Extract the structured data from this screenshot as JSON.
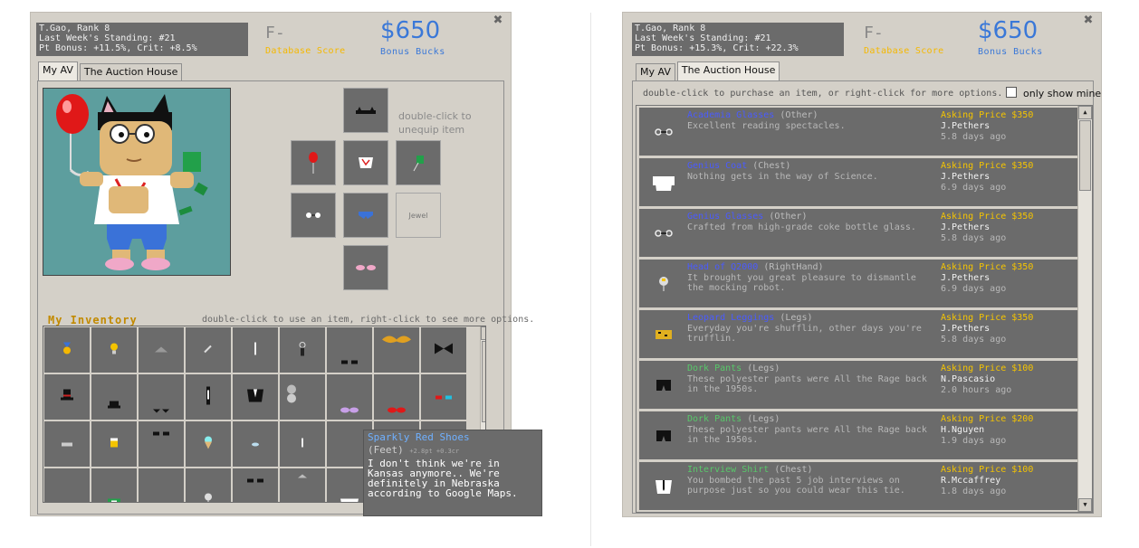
{
  "left": {
    "status": {
      "line1": "T.Gao, Rank 8",
      "line2": "Last Week's Standing: #21",
      "line3": "Pt Bonus: +11.5%, Crit: +8.5%"
    },
    "grade": "F-",
    "grade_sub": "Database Score",
    "money": "$650",
    "money_sub": "Bonus Bucks",
    "tabs": [
      "My AV",
      "The Auction House"
    ],
    "unequip_note_1": "double-click to",
    "unequip_note_2": "unequip item",
    "jewel_label": "Jewel",
    "inventory_title": "My Inventory",
    "inventory_hint": "double-click to use an item, right-click to see more options.",
    "tooltip": {
      "title": "Sparkly Red Shoes",
      "slot": "(Feet)",
      "stats": "+2.8pt +0.3cr",
      "desc": "I don't think we're in Kansas anymore.. We're definitely in Nebraska according to Google Maps."
    }
  },
  "right": {
    "status": {
      "line1": "T.Gao, Rank 8",
      "line2": "Last Week's Standing: #21",
      "line3": "Pt Bonus: +15.3%, Crit: +22.3%"
    },
    "grade": "F-",
    "grade_sub": "Database Score",
    "money": "$650",
    "money_sub": "Bonus Bucks",
    "tabs": [
      "My AV",
      "The Auction House"
    ],
    "instruction": "double-click to purchase an item, or right-click for more options.",
    "only_show_mine": "only show mine",
    "listings": [
      {
        "name": "Academia Glasses",
        "slot": "(Other)",
        "desc": "Excellent reading spectacles.",
        "price": "Asking Price $350",
        "seller": "J.Pethers",
        "age": "5.8 days ago",
        "green": false,
        "icon": "glasses-icon"
      },
      {
        "name": "Genius Coat",
        "slot": "(Chest)",
        "desc": "Nothing gets in the way of Science.",
        "price": "Asking Price $350",
        "seller": "J.Pethers",
        "age": "6.9 days ago",
        "green": false,
        "icon": "coat-icon"
      },
      {
        "name": "Genius Glasses",
        "slot": "(Other)",
        "desc": "Crafted from high-grade coke bottle glass.",
        "price": "Asking Price $350",
        "seller": "J.Pethers",
        "age": "5.8 days ago",
        "green": false,
        "icon": "glasses-icon"
      },
      {
        "name": "Head of Q2000",
        "slot": "(RightHand)",
        "desc": "It brought you great pleasure to dismantle the mocking robot.",
        "price": "Asking Price $350",
        "seller": "J.Pethers",
        "age": "6.9 days ago",
        "green": false,
        "icon": "robot-head-icon"
      },
      {
        "name": "Leopard Leggings",
        "slot": "(Legs)",
        "desc": "Everyday you're shufflin, other days you're trufflin.",
        "price": "Asking Price $350",
        "seller": "J.Pethers",
        "age": "5.8 days ago",
        "green": false,
        "icon": "leggings-icon"
      },
      {
        "name": "Dork Pants",
        "slot": "(Legs)",
        "desc": "These polyester pants were All the Rage back in the 1950s.",
        "price": "Asking Price $100",
        "seller": "N.Pascasio",
        "age": "2.0 hours ago",
        "green": true,
        "icon": "pants-icon"
      },
      {
        "name": "Dork Pants",
        "slot": "(Legs)",
        "desc": "These polyester pants were All the Rage back in the 1950s.",
        "price": "Asking Price $200",
        "seller": "H.Nguyen",
        "age": "1.9 days ago",
        "green": true,
        "icon": "pants-icon"
      },
      {
        "name": "Interview Shirt",
        "slot": "(Chest)",
        "desc": "You bombed the past 5 job interviews on purpose just so you could wear this tie.",
        "price": "Asking Price $100",
        "seller": "R.Mccaffrey",
        "age": "1.8 days ago",
        "green": true,
        "icon": "shirt-tie-icon"
      }
    ]
  },
  "colors": {
    "panel": "#d4d0c8",
    "slot": "#6b6b6b",
    "money": "#3a78d8",
    "score_label": "#f5b800",
    "price": "#f5c400",
    "item_name_blue": "#4a5bff",
    "item_name_green": "#58c86a"
  }
}
